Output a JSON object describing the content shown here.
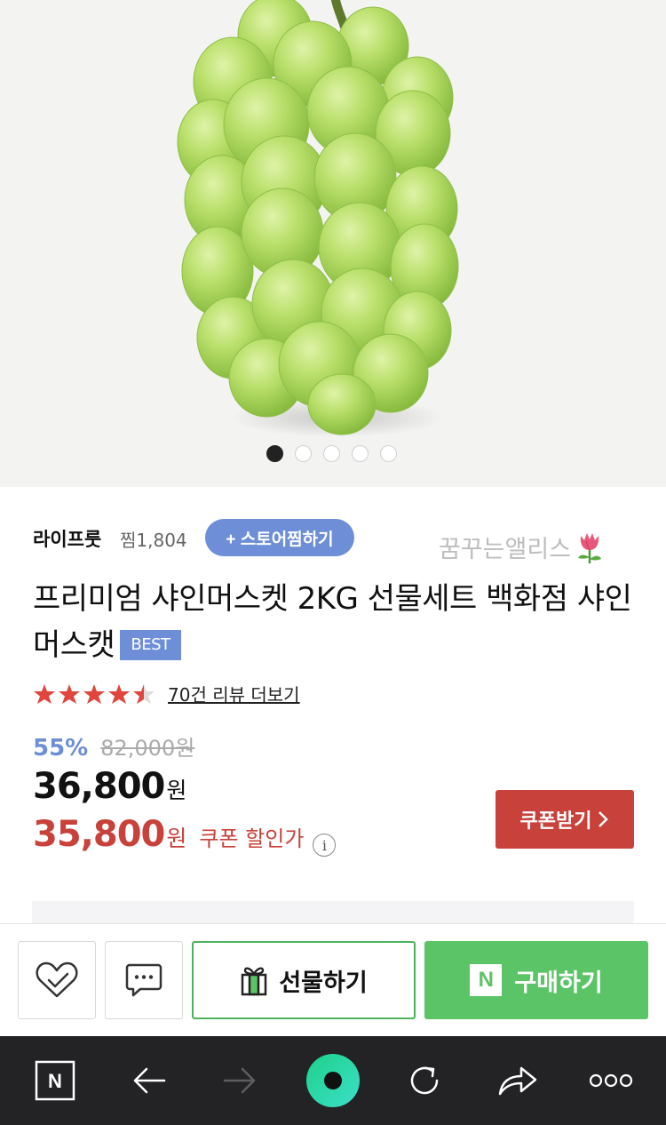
{
  "hero": {
    "image_name": "shine-muscat-grapes-photo",
    "page_count": 5,
    "active_page": 1
  },
  "store": {
    "name": "라이프룻",
    "likes": "찜1,804",
    "like_button": "+ 스토어찜하기"
  },
  "watermark": {
    "text": "꿈꾸는앨리스",
    "icon": "tulip-icon"
  },
  "product": {
    "title": "프리미엄 샤인머스켓 2KG 선물세트 백화점 샤인머스캣",
    "badge": "BEST",
    "rating": 4.5,
    "review_link": "70건 리뷰 더보기"
  },
  "price": {
    "discount_rate": "55%",
    "original": "82,000원",
    "sale": "36,800",
    "sale_unit": "원",
    "coupon_price": "35,800",
    "coupon_unit": "원",
    "coupon_label": "쿠폰 할인가",
    "info_icon": "i",
    "coupon_button": "쿠폰받기",
    "coupon_button_icon": "chevron-right-icon"
  },
  "actions": {
    "like_icon": "heart-check-icon",
    "chat_icon": "chat-bubble-icon",
    "gift_label": "선물하기",
    "gift_icon": "gift-box-icon",
    "buy_label": "구매하기",
    "buy_logo": "N"
  },
  "browser": {
    "home_logo": "N",
    "items": [
      "naver-home-icon",
      "back-arrow-icon",
      "forward-arrow-icon",
      "green-dot-icon",
      "refresh-icon",
      "share-icon",
      "more-icon"
    ]
  },
  "colors": {
    "accent_blue": "#6e8fd8",
    "coupon_red": "#c8413a",
    "naver_green": "#5bc466",
    "toolbar_dark": "#232325"
  }
}
